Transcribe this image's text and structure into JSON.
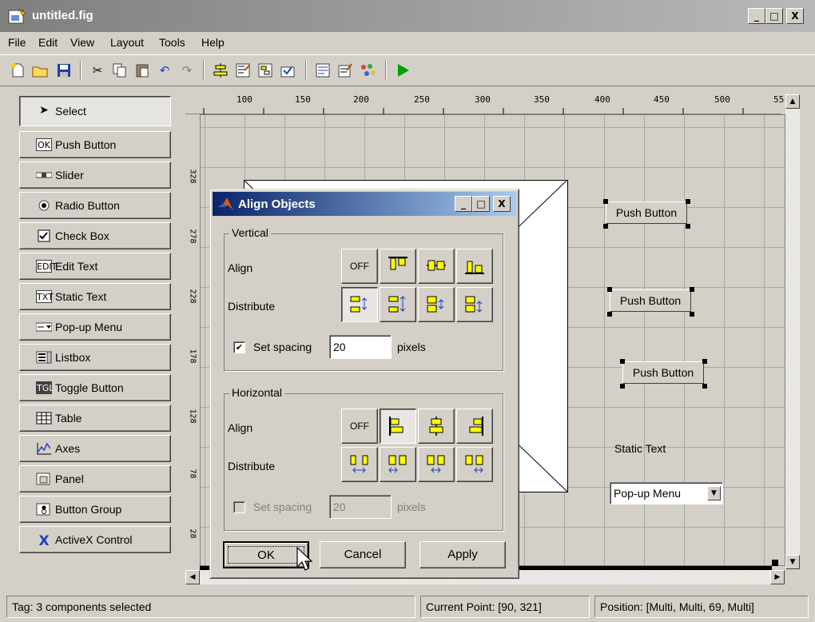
{
  "window": {
    "title": "untitled.fig",
    "minimize": "_",
    "maximize": "□",
    "close": "X"
  },
  "menu": [
    "File",
    "Edit",
    "View",
    "Layout",
    "Tools",
    "Help"
  ],
  "palette": [
    {
      "label": "Select",
      "icon": "arrow-cursor-icon"
    },
    {
      "label": "Push Button",
      "icon": "OK"
    },
    {
      "label": "Slider",
      "icon": "slider"
    },
    {
      "label": "Radio Button",
      "icon": "radio"
    },
    {
      "label": "Check Box",
      "icon": "check"
    },
    {
      "label": "Edit Text",
      "icon": "EDIT"
    },
    {
      "label": "Static Text",
      "icon": "TXT"
    },
    {
      "label": "Pop-up Menu",
      "icon": "popup"
    },
    {
      "label": "Listbox",
      "icon": "list"
    },
    {
      "label": "Toggle Button",
      "icon": "TGL"
    },
    {
      "label": "Table",
      "icon": "table"
    },
    {
      "label": "Axes",
      "icon": "axes"
    },
    {
      "label": "Panel",
      "icon": "panel"
    },
    {
      "label": "Button Group",
      "icon": "bgroup"
    },
    {
      "label": "ActiveX Control",
      "icon": "X"
    }
  ],
  "ruler": {
    "top": [
      "100",
      "150",
      "200",
      "250",
      "300",
      "350",
      "400",
      "450",
      "500",
      "55"
    ],
    "left": [
      "328",
      "278",
      "228",
      "178",
      "128",
      "78",
      "28"
    ]
  },
  "canvas": {
    "push_buttons": [
      "Push Button",
      "Push Button",
      "Push Button"
    ],
    "static_text": "Static Text",
    "popup": "Pop-up Menu"
  },
  "dialog": {
    "title": "Align Objects",
    "vertical": {
      "label": "Vertical",
      "align": "Align",
      "distribute": "Distribute",
      "off": "OFF",
      "set_spacing": "Set spacing",
      "spacing_value": "20",
      "pixels": "pixels",
      "checked": true
    },
    "horizontal": {
      "label": "Horizontal",
      "align": "Align",
      "distribute": "Distribute",
      "off": "OFF",
      "set_spacing": "Set spacing",
      "spacing_value": "20",
      "pixels": "pixels",
      "checked": false
    },
    "ok": "OK",
    "cancel": "Cancel",
    "apply": "Apply"
  },
  "status": {
    "tag": "Tag: 3 components selected",
    "current_point": "Current Point:  [90, 321]",
    "position": "Position: [Multi, Multi, 69, Multi]"
  },
  "colors": {
    "title_gradient_start": "#0a246a",
    "title_gradient_end": "#a6caf0",
    "accent_yellow": "#ffff00",
    "run_green": "#00a000"
  }
}
